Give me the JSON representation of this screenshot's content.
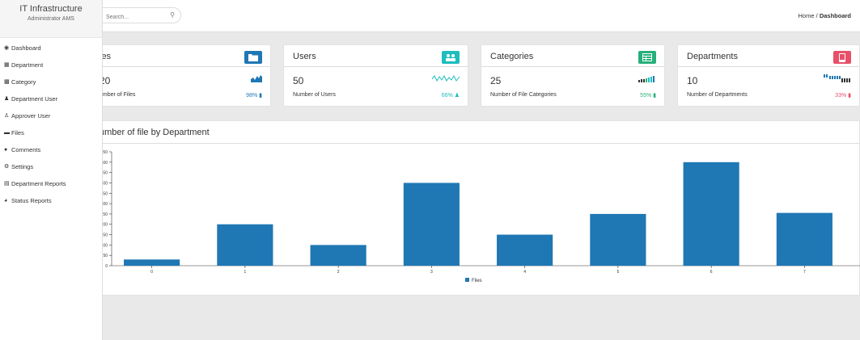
{
  "sidebar": {
    "app_title": "IT Infrastructure",
    "subtitle": "Administrator AMS",
    "items": [
      {
        "label": "Dashboard",
        "icon": "dashboard-icon"
      },
      {
        "label": "Department",
        "icon": "building-icon"
      },
      {
        "label": "Category",
        "icon": "grid-icon"
      },
      {
        "label": "Department User",
        "icon": "users-icon"
      },
      {
        "label": "Approver User",
        "icon": "user-icon"
      },
      {
        "label": "Files",
        "icon": "folder-icon"
      },
      {
        "label": "Comments",
        "icon": "comment-icon"
      },
      {
        "label": "Settings",
        "icon": "gear-icon"
      },
      {
        "label": "Department Reports",
        "icon": "bar-chart-icon"
      },
      {
        "label": "Status Reports",
        "icon": "pie-chart-icon"
      }
    ]
  },
  "topbar": {
    "search_placeholder": "Search...",
    "breadcrumb_home": "Home",
    "breadcrumb_sep": "/",
    "breadcrumb_current": "Dashboard"
  },
  "cards": [
    {
      "label": "les",
      "count": "20",
      "desc": "umber of Files",
      "pct": "98%",
      "color": "#1f77b4",
      "icon": "folder-icon"
    },
    {
      "label": "Users",
      "count": "50",
      "desc": "Number of Users",
      "pct": "66%",
      "color": "#1fbdbd",
      "icon": "users-icon"
    },
    {
      "label": "Categories",
      "count": "25",
      "desc": "Number of File Categories",
      "pct": "55%",
      "color": "#26b07a",
      "icon": "table-icon"
    },
    {
      "label": "Departments",
      "count": "10",
      "desc": "Number of Departments",
      "pct": "33%",
      "color": "#e8506a",
      "icon": "tablet-icon"
    }
  ],
  "panel": {
    "title": "umber of file by Department"
  },
  "chart_data": {
    "type": "bar",
    "categories": [
      "0",
      "1",
      "2",
      "3",
      "4",
      "5",
      "6",
      "7"
    ],
    "series": [
      {
        "name": "Files",
        "values": [
          30,
          200,
          100,
          400,
          150,
          250,
          500,
          255
        ]
      }
    ],
    "ylim": [
      0,
      550
    ],
    "yticks": [
      0,
      50,
      100,
      150,
      200,
      250,
      300,
      350,
      400,
      450,
      500,
      550
    ],
    "ytick_labels": [
      "0",
      "50",
      "100",
      "150",
      "200",
      "250",
      "300",
      "350",
      "400",
      "450",
      "500",
      "550"
    ],
    "bar_color": "#1f77b4",
    "legend": "bottom-center",
    "grid": false
  }
}
